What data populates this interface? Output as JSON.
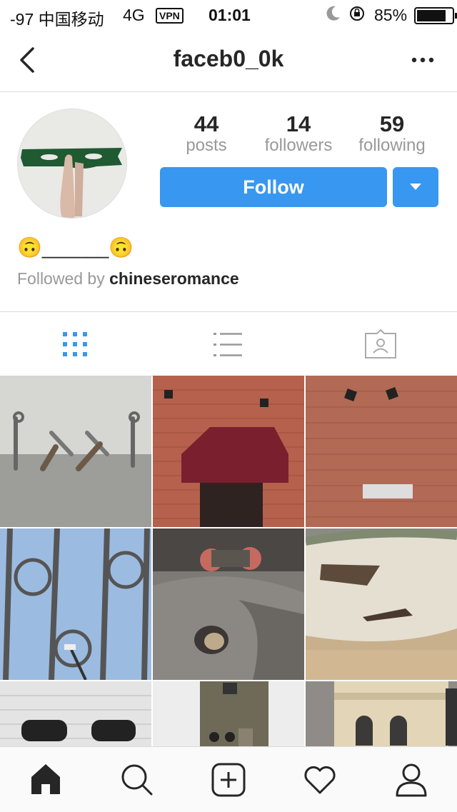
{
  "status_bar": {
    "carrier": "-97 中国移动",
    "network": "4G",
    "vpn": "VPN",
    "time": "01:01",
    "battery": "85%"
  },
  "header": {
    "back_icon": "chevron-left-icon",
    "username": "faceb0_0k",
    "more_icon": "more-horizontal-icon"
  },
  "profile": {
    "stats": [
      {
        "value": "44",
        "label": "posts"
      },
      {
        "value": "14",
        "label": "followers"
      },
      {
        "value": "59",
        "label": "following"
      }
    ],
    "follow_label": "Follow",
    "bio": "🙃______🙃",
    "followed_by_prefix": "Followed by",
    "followed_by_user": "chineseromance"
  },
  "tabs": [
    {
      "icon": "grid-icon",
      "active": true
    },
    {
      "icon": "list-icon",
      "active": false
    },
    {
      "icon": "tagged-icon",
      "active": false
    }
  ],
  "bottom_nav": [
    {
      "icon": "home-icon"
    },
    {
      "icon": "search-icon"
    },
    {
      "icon": "add-post-icon"
    },
    {
      "icon": "activity-heart-icon"
    },
    {
      "icon": "profile-icon"
    }
  ],
  "colors": {
    "accent": "#3897f0",
    "text": "#262626",
    "muted": "#999999",
    "divider": "#dbdbdb"
  }
}
